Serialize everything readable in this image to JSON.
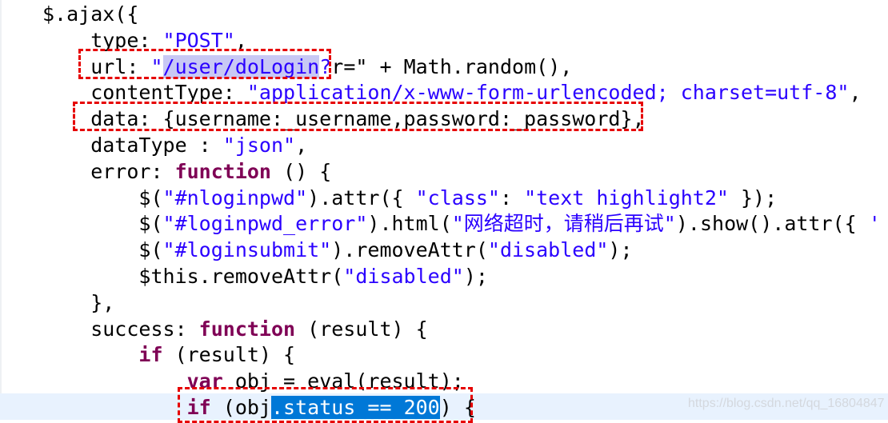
{
  "editor": {
    "colors": {
      "keyword": "#7f0055",
      "string": "#2a00ff",
      "plain": "#000000",
      "selection": "#c8c8f4",
      "active_selection": "#0078d7",
      "current_line": "#e8f2fe",
      "annotation_box": "#e60000"
    },
    "lines": [
      [
        {
          "t": "$.ajax({",
          "c": "p"
        }
      ],
      [
        {
          "t": "    type: ",
          "c": "p"
        },
        {
          "t": "\"POST\"",
          "c": "s"
        },
        {
          "t": ",",
          "c": "p"
        }
      ],
      [
        {
          "t": "    url: ",
          "c": "p"
        },
        {
          "t": "\"",
          "c": "s"
        },
        {
          "t": "/user/doLogin",
          "c": "s",
          "sel": "sel"
        },
        {
          "t": "?",
          "c": "s"
        },
        {
          "t": "r=\" + Math.random(),",
          "c": "p"
        }
      ],
      [
        {
          "t": "    contentType: ",
          "c": "p"
        },
        {
          "t": "\"application/x-www-form-urlencoded; charset=utf-8\"",
          "c": "s"
        },
        {
          "t": ",",
          "c": "p"
        }
      ],
      [
        {
          "t": "    data: {username:_username,password:_password},",
          "c": "p"
        }
      ],
      [
        {
          "t": "    dataType : ",
          "c": "p"
        },
        {
          "t": "\"json\"",
          "c": "s"
        },
        {
          "t": ",",
          "c": "p"
        }
      ],
      [
        {
          "t": "    error: ",
          "c": "p"
        },
        {
          "t": "function",
          "c": "k"
        },
        {
          "t": " () {",
          "c": "p"
        }
      ],
      [
        {
          "t": "        $(",
          "c": "p"
        },
        {
          "t": "\"#nloginpwd\"",
          "c": "s"
        },
        {
          "t": ").attr({ ",
          "c": "p"
        },
        {
          "t": "\"class\"",
          "c": "s"
        },
        {
          "t": ": ",
          "c": "p"
        },
        {
          "t": "\"text highlight2\"",
          "c": "s"
        },
        {
          "t": " });",
          "c": "p"
        }
      ],
      [
        {
          "t": "        $(",
          "c": "p"
        },
        {
          "t": "\"#loginpwd_error\"",
          "c": "s"
        },
        {
          "t": ").html(",
          "c": "p"
        },
        {
          "t": "\"网络超时，请稍后再试\"",
          "c": "s"
        },
        {
          "t": ").show().attr({ ",
          "c": "p"
        },
        {
          "t": "'",
          "c": "s"
        }
      ],
      [
        {
          "t": "        $(",
          "c": "p"
        },
        {
          "t": "\"#loginsubmit\"",
          "c": "s"
        },
        {
          "t": ").removeAttr(",
          "c": "p"
        },
        {
          "t": "\"disabled\"",
          "c": "s"
        },
        {
          "t": ");",
          "c": "p"
        }
      ],
      [
        {
          "t": "        $this.removeAttr(",
          "c": "p"
        },
        {
          "t": "\"disabled\"",
          "c": "s"
        },
        {
          "t": ");",
          "c": "p"
        }
      ],
      [
        {
          "t": "    },",
          "c": "p"
        }
      ],
      [
        {
          "t": "    success: ",
          "c": "p"
        },
        {
          "t": "function",
          "c": "k"
        },
        {
          "t": " (result) {",
          "c": "p"
        }
      ],
      [
        {
          "t": "        ",
          "c": "p"
        },
        {
          "t": "if",
          "c": "k"
        },
        {
          "t": " (result) {",
          "c": "p"
        }
      ],
      [
        {
          "t": "            ",
          "c": "p"
        },
        {
          "t": "var",
          "c": "k"
        },
        {
          "t": " obj = eval(result);",
          "c": "p"
        }
      ],
      [
        {
          "t": "            ",
          "c": "p"
        },
        {
          "t": "if",
          "c": "k"
        },
        {
          "t": " (obj",
          "c": "p"
        },
        {
          "t": ".status == 200",
          "c": "p",
          "sel": "sel2"
        },
        {
          "t": ") {",
          "c": "p"
        }
      ]
    ]
  },
  "watermark": "https://blog.csdn.net/qq_16804847"
}
